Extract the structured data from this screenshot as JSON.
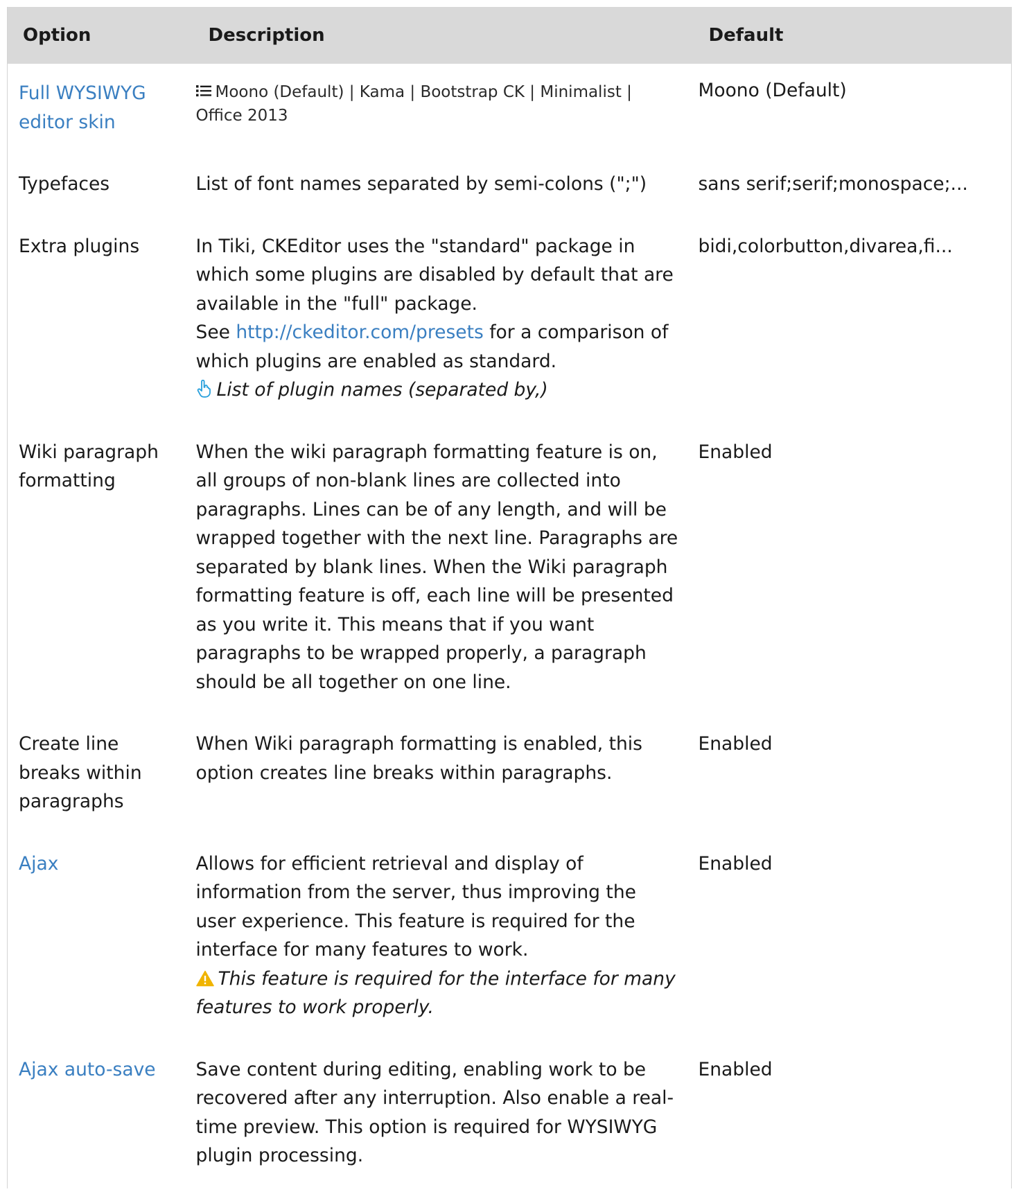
{
  "header": {
    "option": "Option",
    "description": "Description",
    "default": "Default"
  },
  "rows": [
    {
      "option": "Full WYSIWYG editor skin",
      "option_is_link": true,
      "description_options": "Moono (Default) | Kama | Bootstrap CK | Minimalist | Office 2013",
      "default": "Moono (Default)"
    },
    {
      "option": "Typefaces",
      "option_is_link": false,
      "description": "List of font names separated by semi-colons (\";\")",
      "default": "sans serif;serif;monospace;..."
    },
    {
      "option": "Extra plugins",
      "option_is_link": false,
      "description_before_link": "In Tiki, CKEditor uses the \"standard\" package in which some plugins are disabled by default that are available in the \"full\" package.",
      "description_see": "See",
      "description_link": "http://ckeditor.com/presets",
      "description_after_link": "for a comparison of which plugins are enabled as standard.",
      "hint": "List of plugin names (separated by,)",
      "default": "bidi,colorbutton,divarea,fi..."
    },
    {
      "option": "Wiki paragraph formatting",
      "option_is_link": false,
      "description": "When the wiki paragraph formatting feature is on, all groups of non-blank lines are collected into paragraphs. Lines can be of any length, and will be wrapped together with the next line. Paragraphs are separated by blank lines. When the Wiki paragraph formatting feature is off, each line will be presented as you write it. This means that if you want paragraphs to be wrapped properly, a paragraph should be all together on one line.",
      "default": "Enabled"
    },
    {
      "option": "Create line breaks within paragraphs",
      "option_is_link": false,
      "description": "When Wiki paragraph formatting is enabled, this option creates line breaks within paragraphs.",
      "default": "Enabled"
    },
    {
      "option": "Ajax",
      "option_is_link": true,
      "description": "Allows for efficient retrieval and display of information from the server, thus improving the user experience. This feature is required for the interface for many features to work.",
      "warning": "This feature is required for the interface for many features to work properly.",
      "default": "Enabled"
    },
    {
      "option": "Ajax auto-save",
      "option_is_link": true,
      "description": "Save content during editing, enabling work to be recovered after any interruption. Also enable a real-time preview. This option is required for WYSIWYG plugin processing.",
      "default": "Enabled"
    }
  ],
  "colors": {
    "link": "#3a7fc1",
    "header_bg": "#d9d9d9",
    "warning": "#f0b400",
    "hint_icon": "#29a0dc"
  },
  "icons": {
    "list": "list-icon",
    "hint": "pointing-hand-icon",
    "warning": "warning-icon"
  }
}
